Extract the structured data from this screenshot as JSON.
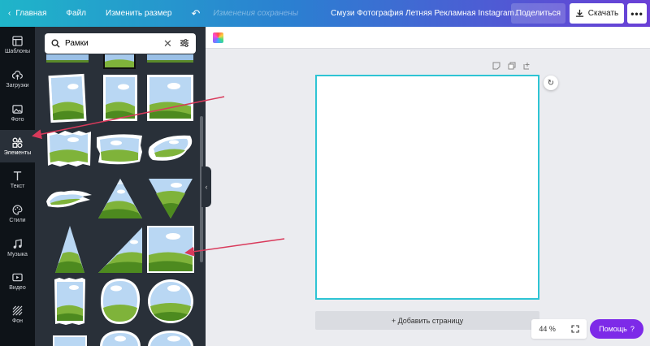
{
  "topbar": {
    "home": "Главная",
    "file": "Файл",
    "resize": "Изменить размер",
    "saved": "Изменения сохранены",
    "title": "Смузи Фотография Летняя Рекламная Instagram Публ...",
    "share": "Поделиться",
    "download": "Скачать",
    "more": "•••"
  },
  "rail": {
    "templates": "Шаблоны",
    "uploads": "Загрузки",
    "photos": "Фото",
    "elements": "Элементы",
    "text": "Текст",
    "styles": "Стили",
    "music": "Музыка",
    "video": "Видео",
    "background": "Фон"
  },
  "panel": {
    "search_value": "Рамки"
  },
  "editor": {
    "add_page": "+ Добавить страницу",
    "zoom": "44 %",
    "help": "Помощь",
    "help_icon": "?"
  },
  "colors": {
    "accent": "#7d2ae8",
    "annotation": "#d93a5b",
    "canvas_border": "#2ec4d4"
  }
}
